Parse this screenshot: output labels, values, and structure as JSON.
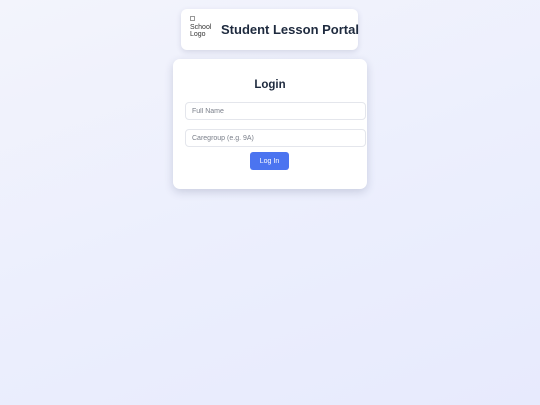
{
  "header": {
    "logo_alt": "School Logo",
    "logo_line1": "School",
    "logo_line2": "Logo",
    "title": "Student Lesson Portal"
  },
  "login": {
    "title": "Login",
    "full_name_placeholder": "Full Name",
    "full_name_value": "",
    "caregroup_placeholder": "Caregroup (e.g. 9A)",
    "caregroup_value": "",
    "button_label": "Log In"
  },
  "colors": {
    "accent": "#4b74f0",
    "title_text": "#1e2a3e",
    "background": "#eceffd"
  }
}
